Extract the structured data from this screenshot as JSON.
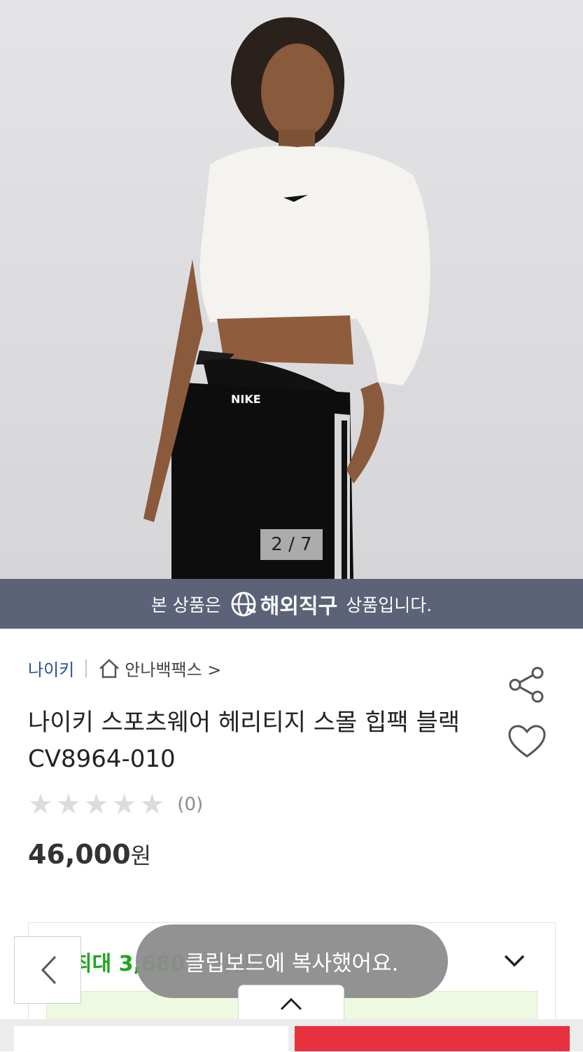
{
  "gallery": {
    "counter": "2 / 7"
  },
  "banner": {
    "prefix": "본 상품은",
    "highlight": "해외직구",
    "suffix": "상품입니다."
  },
  "breadcrumb": {
    "brand": "나이키",
    "store": "안나백팩스 >"
  },
  "product": {
    "title": "나이키 스포츠웨어 헤리티지 스몰 힙팩 블랙 CV8964-010"
  },
  "rating": {
    "stars": 0,
    "max_stars": 5,
    "review_count": "(0)"
  },
  "price": {
    "amount": "46,000",
    "unit": "원"
  },
  "benefits": {
    "points": "최대 3,680원 적립"
  },
  "toast": {
    "message": "클립보드에 복사했어요."
  },
  "colors": {
    "banner": "#5c6277",
    "brand": "#2b4f9a",
    "points": "#21a51e",
    "buy": "#e8313e"
  },
  "icons": [
    "globe-plane-icon",
    "home-icon",
    "share-icon",
    "heart-icon",
    "star-icon",
    "chevron-down-icon",
    "chevron-left-icon",
    "chevron-up-icon"
  ]
}
